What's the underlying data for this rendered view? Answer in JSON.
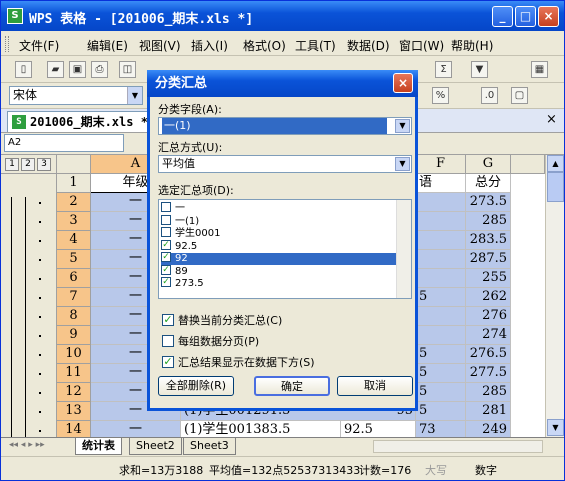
{
  "window": {
    "title": "WPS 表格 - [201006_期末.xls *]",
    "min": "_",
    "max": "□",
    "close": "×"
  },
  "menu": [
    "文件(F)",
    "编辑(E)",
    "视图(V)",
    "插入(I)",
    "格式(O)",
    "工具(T)",
    "数据(D)",
    "窗口(W)",
    "帮助(H)"
  ],
  "font_name": "宋体",
  "doc_tab": "201006_期末.xls *",
  "name_box": "A2",
  "levels": [
    "1",
    "2",
    "3"
  ],
  "columns": [
    {
      "label": "A",
      "sel": true
    },
    {
      "label": "F",
      "sel": false
    },
    {
      "label": "G",
      "sel": false
    }
  ],
  "rows": [
    {
      "n": "1",
      "a": "年级",
      "f": "语",
      "g": "总分"
    },
    {
      "n": "2",
      "a": "一",
      "f": "",
      "g": "273.5"
    },
    {
      "n": "3",
      "a": "一",
      "f": "",
      "g": "285"
    },
    {
      "n": "4",
      "a": "一",
      "f": "",
      "g": "283.5"
    },
    {
      "n": "5",
      "a": "一",
      "f": "",
      "g": "287.5"
    },
    {
      "n": "6",
      "a": "一",
      "f": "",
      "g": "255"
    },
    {
      "n": "7",
      "a": "一",
      "f": "5",
      "g": "262"
    },
    {
      "n": "8",
      "a": "一",
      "f": "",
      "g": "276"
    },
    {
      "n": "9",
      "a": "一",
      "f": "",
      "g": "274"
    },
    {
      "n": "10",
      "a": "一",
      "f": "5",
      "g": "276.5"
    },
    {
      "n": "11",
      "a": "一",
      "f": "5",
      "g": "277.5"
    },
    {
      "n": "12",
      "a": "一",
      "f": "5",
      "g": "285"
    },
    {
      "n": "13",
      "a": "一",
      "f": "5",
      "g": "281"
    },
    {
      "n": "14",
      "a": "一",
      "f": "73",
      "g": "249"
    }
  ],
  "partial_cells": {
    "row13": "(1)学生001291.5",
    "row13b": "95",
    "row14": "(1)学生001383.5",
    "row14b": "92.5"
  },
  "sheets": [
    "统计表",
    "Sheet2",
    "Sheet3"
  ],
  "status": {
    "sum": "求和=13万3188",
    "avg": "平均值=132点52537313433",
    "count": "计数=176",
    "caps": "大写",
    "num": "数字"
  },
  "dialog": {
    "title": "分类汇总",
    "field_label": "分类字段(A):",
    "field_value": "一(1)",
    "method_label": "汇总方式(U):",
    "method_value": "平均值",
    "items_label": "选定汇总项(D):",
    "items": [
      {
        "text": "一",
        "checked": false,
        "selected": false
      },
      {
        "text": "一(1)",
        "checked": false,
        "selected": false
      },
      {
        "text": "学生0001",
        "checked": false,
        "selected": false
      },
      {
        "text": "92.5",
        "checked": true,
        "selected": false
      },
      {
        "text": "92",
        "checked": true,
        "selected": true
      },
      {
        "text": "89",
        "checked": true,
        "selected": false
      },
      {
        "text": "273.5",
        "checked": true,
        "selected": false
      }
    ],
    "replace_label": "替换当前分类汇总(C)",
    "pagebreak_label": "每组数据分页(P)",
    "below_label": "汇总结果显示在数据下方(S)",
    "remove_all": "全部删除(R)",
    "ok": "确定",
    "cancel": "取消"
  }
}
